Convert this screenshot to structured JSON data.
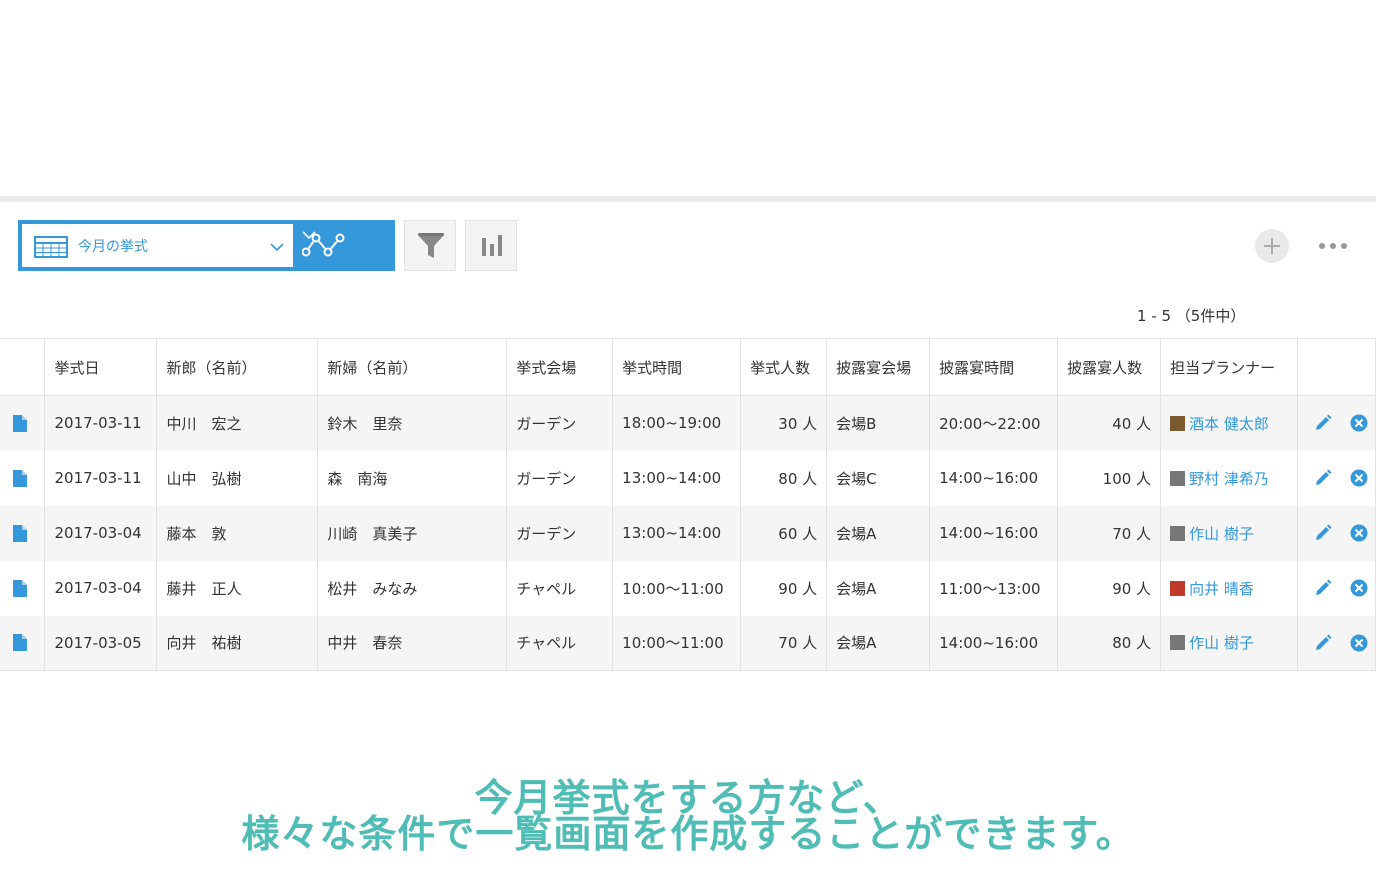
{
  "toolbar": {
    "view_name": "今月の挙式",
    "icons": {
      "view_type": "table-icon",
      "graph": "graph-line-icon",
      "filter": "funnel-icon",
      "chart": "bar-chart-icon",
      "add": "plus-icon",
      "more": "more-dots-icon"
    }
  },
  "pager": {
    "text": "1 - 5 （5件中）"
  },
  "table": {
    "headers": [
      "挙式日",
      "新郎（名前）",
      "新婦（名前）",
      "挙式会場",
      "挙式時間",
      "挙式人数",
      "披露宴会場",
      "披露宴時間",
      "披露宴人数",
      "担当プランナー"
    ],
    "rows": [
      {
        "date": "2017-03-11",
        "groom": "中川　宏之",
        "bride": "鈴木　里奈",
        "venue": "ガーデン",
        "time": "18:00~19:00",
        "guests": "30 人",
        "reception_venue": "会場B",
        "reception_time": "20:00～22:00",
        "reception_guests": "40 人",
        "planner": "酒本 健太郎",
        "avatar_color": "#7a5a2e"
      },
      {
        "date": "2017-03-11",
        "groom": "山中　弘樹",
        "bride": "森　南海",
        "venue": "ガーデン",
        "time": "13:00~14:00",
        "guests": "80 人",
        "reception_venue": "会場C",
        "reception_time": "14:00~16:00",
        "reception_guests": "100 人",
        "planner": "野村 津希乃",
        "avatar_color": "#777777"
      },
      {
        "date": "2017-03-04",
        "groom": "藤本　敦",
        "bride": "川崎　真美子",
        "venue": "ガーデン",
        "time": "13:00~14:00",
        "guests": "60 人",
        "reception_venue": "会場A",
        "reception_time": "14:00~16:00",
        "reception_guests": "70 人",
        "planner": "作山 樹子",
        "avatar_color": "#777777"
      },
      {
        "date": "2017-03-04",
        "groom": "藤井　正人",
        "bride": "松井　みなみ",
        "venue": "チャペル",
        "time": "10:00～11:00",
        "guests": "90 人",
        "reception_venue": "会場A",
        "reception_time": "11:00～13:00",
        "reception_guests": "90 人",
        "planner": "向井 晴香",
        "avatar_color": "#c0392b"
      },
      {
        "date": "2017-03-05",
        "groom": "向井　祐樹",
        "bride": "中井　春奈",
        "venue": "チャペル",
        "time": "10:00～11:00",
        "guests": "70 人",
        "reception_venue": "会場A",
        "reception_time": "14:00~16:00",
        "reception_guests": "80 人",
        "planner": "作山 樹子",
        "avatar_color": "#777777"
      }
    ]
  },
  "caption": {
    "line1": "今月挙式をする方など、",
    "line2": "様々な条件で一覧画面を作成することができます。"
  },
  "colors": {
    "accent": "#3498db",
    "caption": "#4fbdb5",
    "row_alt": "#f5f5f5"
  }
}
